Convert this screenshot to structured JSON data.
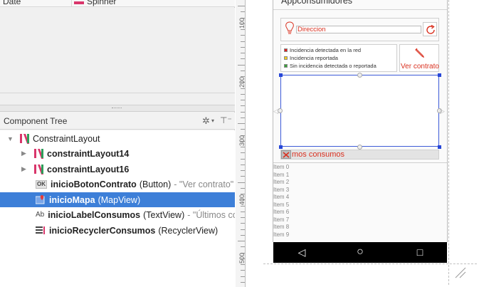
{
  "attributes": {
    "name": "Date",
    "value": "Spinner"
  },
  "component_tree": {
    "title": "Component Tree",
    "gear_icon": "gear-icon",
    "collapse_icon": "collapse-all-icon",
    "items": [
      {
        "id": "ConstraintLayout",
        "type": "",
        "text": ""
      },
      {
        "id": "constraintLayout14",
        "type": "",
        "text": ""
      },
      {
        "id": "constraintLayout16",
        "type": "",
        "text": ""
      },
      {
        "id": "inicioBotonContrato",
        "type": "(Button)",
        "text": "- \"Ver contrato\""
      },
      {
        "id": "inicioMapa",
        "type": "(MapView)",
        "text": ""
      },
      {
        "id": "inicioLabelConsumos",
        "type": "(TextView)",
        "text": "- \"Últimos cons"
      },
      {
        "id": "inicioRecyclerConsumos",
        "type": "(RecyclerView)",
        "text": ""
      }
    ],
    "selected_index": 4
  },
  "ruler": {
    "labels": [
      "100",
      "200",
      "300",
      "400",
      "500"
    ]
  },
  "preview": {
    "title": "Appconsumidores",
    "direccion_placeholder": "Direccion",
    "legend": [
      {
        "label": "Incidencia detectada en la red",
        "color": "#e02020"
      },
      {
        "label": "Incidencia reportada",
        "color": "#f5d020"
      },
      {
        "label": "Sin incidencia detectada o reportada",
        "color": "#3aa33a"
      }
    ],
    "ver_contrato_label": "Ver contrato",
    "consumos_label": "mos consumos",
    "recycler_items": [
      "Item 0",
      "Item 1",
      "Item 2",
      "Item 3",
      "Item 4",
      "Item 5",
      "Item 6",
      "Item 7",
      "Item 8",
      "Item 9"
    ],
    "nav": {
      "back": "◁",
      "home": "○",
      "recents": "□"
    }
  },
  "colors": {
    "accent_red": "#d9301f",
    "selection_blue": "#3d7fd8",
    "constraint_blue": "#2747d8"
  }
}
